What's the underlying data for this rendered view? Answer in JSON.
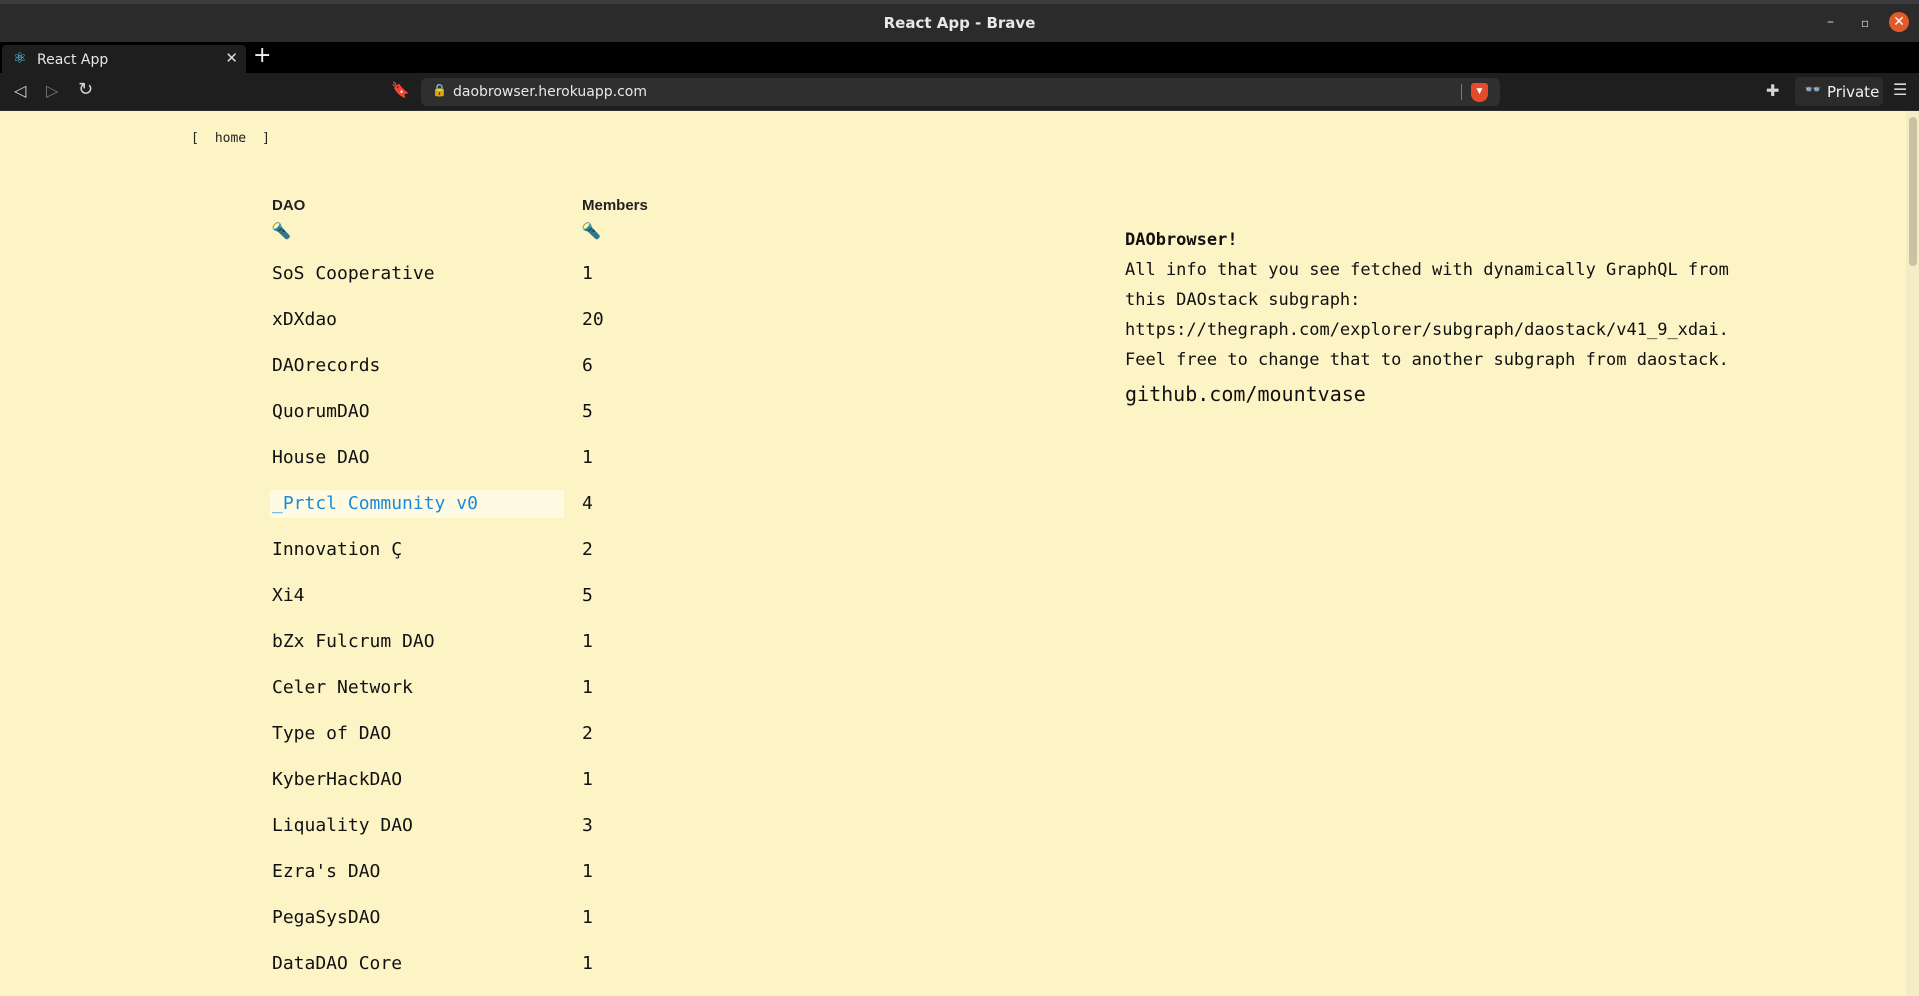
{
  "window": {
    "title": "React App - Brave",
    "minimize_glyph": "–",
    "maximize_glyph": "▫",
    "close_glyph": "✕"
  },
  "tab": {
    "favicon": "⚛",
    "label": "React App",
    "close_glyph": "✕",
    "new_tab_glyph": "+"
  },
  "toolbar": {
    "back_glyph": "◁",
    "forward_glyph": "▷",
    "reload_glyph": "↻",
    "bookmark_glyph": "🔖",
    "lock_glyph": "🔒",
    "url": "daobrowser.herokuapp.com",
    "shield_glyph": "▼",
    "extensions_glyph": "✚",
    "private_glyph": "👓",
    "private_label": "Private",
    "menu_glyph": "☰"
  },
  "nav": {
    "open_bracket": "[",
    "home": "home",
    "close_bracket": "]"
  },
  "table": {
    "columns": [
      "DAO",
      "Members"
    ],
    "sort_icon": "🔦",
    "rows": [
      {
        "name": "SoS Cooperative",
        "members": "1"
      },
      {
        "name": "xDXdao",
        "members": "20"
      },
      {
        "name": "DAOrecords",
        "members": "6"
      },
      {
        "name": "QuorumDAO",
        "members": "5"
      },
      {
        "name": "House DAO",
        "members": "1"
      },
      {
        "name": "_Prtcl Community v0",
        "members": "4",
        "highlighted": true
      },
      {
        "name": "Innovation Ç",
        "members": "2"
      },
      {
        "name": "Xi4",
        "members": "5"
      },
      {
        "name": "bZx Fulcrum DAO",
        "members": "1"
      },
      {
        "name": "Celer Network",
        "members": "1"
      },
      {
        "name": "Type of DAO",
        "members": "2"
      },
      {
        "name": "KyberHackDAO",
        "members": "1"
      },
      {
        "name": "Liquality DAO",
        "members": "3"
      },
      {
        "name": "Ezra's DAO",
        "members": "1"
      },
      {
        "name": "PegaSysDAO",
        "members": "1"
      },
      {
        "name": "DataDAO Core",
        "members": "1"
      }
    ]
  },
  "info": {
    "title": "DAObrowser!",
    "lines": [
      "All info that you see fetched with dynamically GraphQL from",
      "this DAOstack subgraph:",
      "https://thegraph.com/explorer/subgraph/daostack/v41_9_xdai.",
      "Feel free to change that to another subgraph from daostack."
    ],
    "github": "github.com/mountvase"
  },
  "colors": {
    "page_bg": "#fdf4c6",
    "link_highlight": "#1a8bd8",
    "chrome_dark": "#1e1e1e"
  }
}
